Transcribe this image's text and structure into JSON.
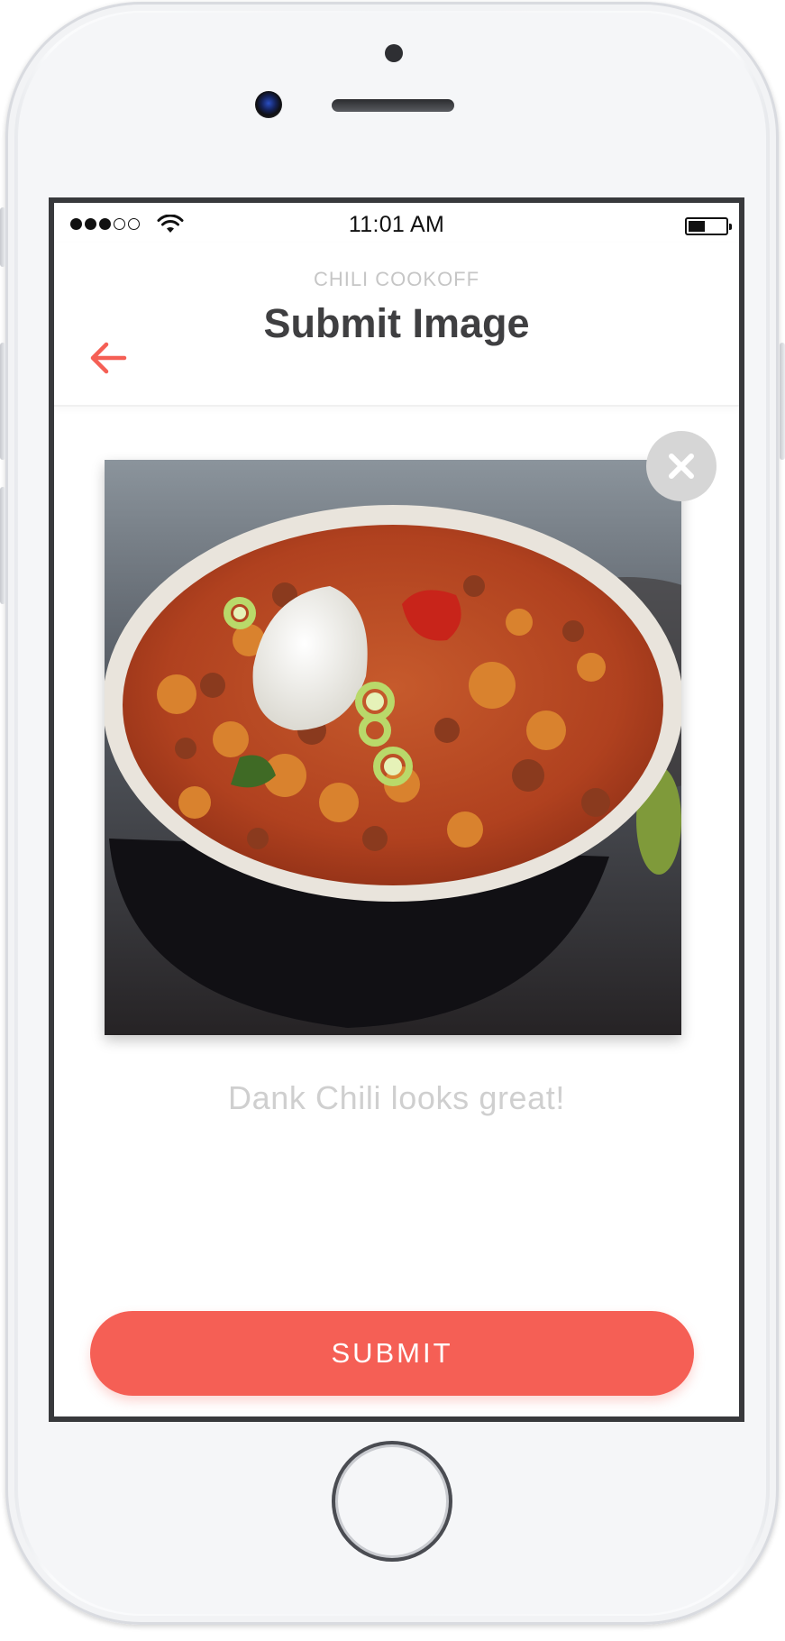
{
  "status_bar": {
    "time": "11:01 AM",
    "signal_icon": "signal-dots-icon",
    "wifi_icon": "wifi-icon",
    "battery_icon": "battery-icon"
  },
  "header": {
    "overline": "CHILI COOKOFF",
    "title": "Submit Image",
    "back_icon": "back-arrow-icon"
  },
  "image_preview": {
    "subject": "bowl of chili with sour cream and green onions",
    "remove_icon": "close-icon"
  },
  "caption": "Dank Chili looks great!",
  "submit_label": "SUBMIT",
  "colors": {
    "accent": "#f55f55",
    "title": "#3f3f41",
    "muted": "#c6c6c6"
  }
}
